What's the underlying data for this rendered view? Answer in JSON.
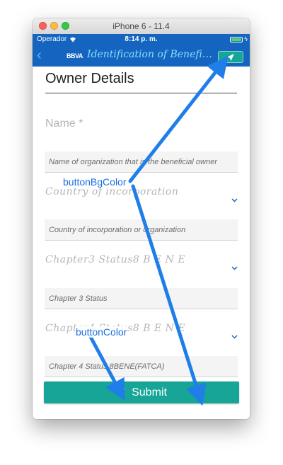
{
  "window": {
    "title": "iPhone 6 - 11.4"
  },
  "status_bar": {
    "carrier": "Operador",
    "time": "8:14 p. m."
  },
  "nav": {
    "logo": "BBVA",
    "title": "Identification of Beneficial Owner"
  },
  "form": {
    "section_title": "Owner Details",
    "fields": [
      {
        "label": "Name *",
        "placeholder": "Name of organization that is the beneficial owner"
      },
      {
        "label": "Country of incorporation",
        "placeholder": "Country of incorporation or organization"
      },
      {
        "label": "Chapter3 Status8 B E N E",
        "placeholder": "Chapter 3 Status"
      },
      {
        "label": "Chapter4 Status8 B E N E",
        "placeholder": "Chapter 4 Status 8BENE(FATCA)"
      }
    ],
    "submit_label": "Submit"
  },
  "annotations": {
    "button_bg_color": "buttonBgColor",
    "button_color": "buttonColor"
  },
  "colors": {
    "nav_bar": "#1565c0",
    "button_bg": "#16a596",
    "annotation_arrow": "#1f7ee8"
  }
}
